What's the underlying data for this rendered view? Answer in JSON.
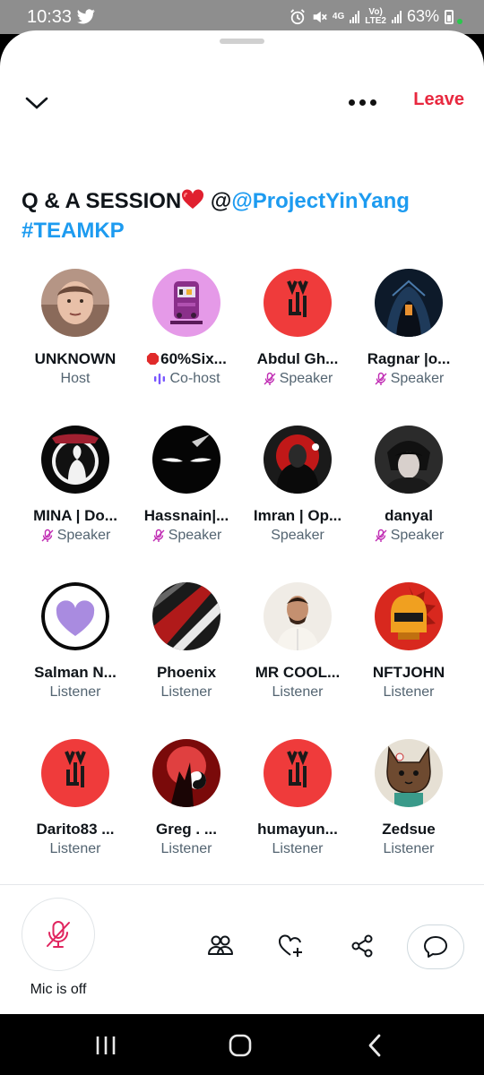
{
  "status_bar": {
    "time": "10:33",
    "network_4g_top": "4G",
    "network_volte_top": "Vo)",
    "network_volte_bottom": "LTE2",
    "battery": "63%"
  },
  "header": {
    "collapse_icon": "chevron-down-icon",
    "more_icon": "more-horizontal-icon",
    "leave_label": "Leave"
  },
  "space": {
    "title_prefix": "Q & A SESSION",
    "title_at": " @",
    "title_mention": "@ProjectYinYang",
    "title_hashtag": "#TEAMKP"
  },
  "participants": [
    {
      "name": "UNKNOWN",
      "role": "Host",
      "mic": "none"
    },
    {
      "name": "60%Six...",
      "role": "Co-host",
      "mic": "speaking"
    },
    {
      "name": "Abdul Gh...",
      "role": "Speaker",
      "mic": "muted"
    },
    {
      "name": "Ragnar |o...",
      "role": "Speaker",
      "mic": "muted"
    },
    {
      "name": "MINA | Do...",
      "role": "Speaker",
      "mic": "muted"
    },
    {
      "name": "Hassnain|...",
      "role": "Speaker",
      "mic": "muted"
    },
    {
      "name": "Imran | Op...",
      "role": "Speaker",
      "mic": "none"
    },
    {
      "name": "danyal",
      "role": "Speaker",
      "mic": "muted"
    },
    {
      "name": "Salman N...",
      "role": "Listener",
      "mic": "none"
    },
    {
      "name": "Phoenix",
      "role": "Listener",
      "mic": "none"
    },
    {
      "name": "MR COOL...",
      "role": "Listener",
      "mic": "none"
    },
    {
      "name": "NFTJOHN",
      "role": "Listener",
      "mic": "none"
    },
    {
      "name": "Darito83 ...",
      "role": "Listener",
      "mic": "none"
    },
    {
      "name": "Greg . ...",
      "role": "Listener",
      "mic": "none"
    },
    {
      "name": "humayun...",
      "role": "Listener",
      "mic": "none"
    },
    {
      "name": "Zedsue",
      "role": "Listener",
      "mic": "none"
    }
  ],
  "bottom_bar": {
    "mic_label": "Mic is off",
    "actions": [
      "people-icon",
      "heart-plus-icon",
      "share-icon",
      "reply-icon"
    ]
  },
  "nav_bar": {
    "items": [
      "recents-icon",
      "home-icon",
      "back-icon"
    ]
  },
  "colors": {
    "accent_red": "#e8283f",
    "link_blue": "#1d9bf0",
    "muted_mic": "#c02bb3",
    "speaking_purple": "#7856ff"
  }
}
